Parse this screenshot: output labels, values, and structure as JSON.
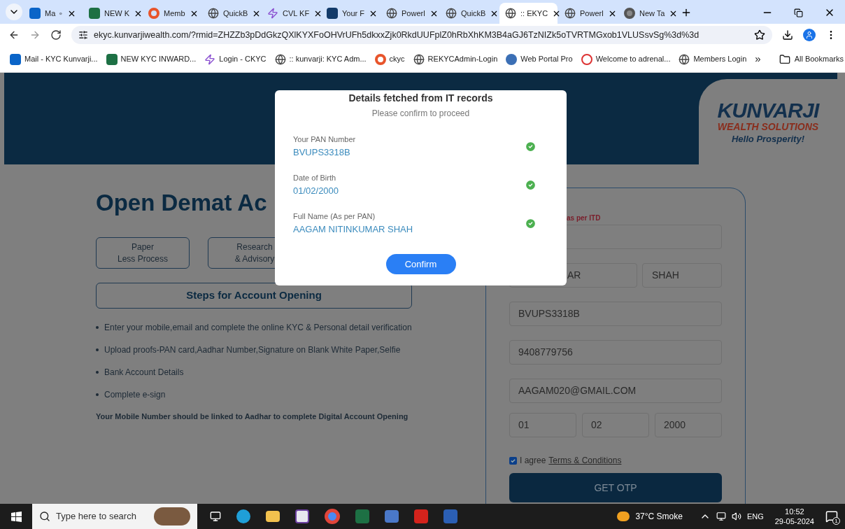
{
  "browser": {
    "tabs": [
      {
        "title": "Ma",
        "kind": "outlook",
        "audio": true,
        "selected": false
      },
      {
        "title": "NEW K",
        "kind": "excel",
        "audio": false,
        "selected": false
      },
      {
        "title": "Memb",
        "kind": "ring",
        "audio": false,
        "selected": false
      },
      {
        "title": "QuickB",
        "kind": "globe",
        "audio": false,
        "selected": false
      },
      {
        "title": "CVL KF",
        "kind": "bolt",
        "audio": false,
        "selected": false
      },
      {
        "title": "Your F",
        "kind": "k",
        "audio": false,
        "selected": false
      },
      {
        "title": "Powerl",
        "kind": "globe",
        "audio": false,
        "selected": false
      },
      {
        "title": "QuickB",
        "kind": "globe",
        "audio": false,
        "selected": false
      },
      {
        "title": ":: EKYC",
        "kind": "globe",
        "audio": false,
        "selected": true
      },
      {
        "title": "Powerl",
        "kind": "globe",
        "audio": false,
        "selected": false
      },
      {
        "title": "New Ta",
        "kind": "chrome",
        "audio": false,
        "selected": false
      }
    ],
    "url": "ekyc.kunvarjiwealth.com/?rmid=ZHZZb3pDdGkzQXlKYXFoOHVrUFh5dkxxZjk0RkdUUFplZ0hRbXhKM3B4aGJ6TzNIZk5oTVRTMGxob1VLUSsvSg%3d%3d",
    "bookmarks": [
      {
        "title": "Mail - KYC Kunvarji...",
        "kind": "outlook"
      },
      {
        "title": "NEW KYC INWARD...",
        "kind": "excel"
      },
      {
        "title": "Login - CKYC",
        "kind": "bolt"
      },
      {
        "title": ":: kunvarji: KYC Adm...",
        "kind": "globe"
      },
      {
        "title": "ckyc",
        "kind": "ring"
      },
      {
        "title": "REKYCAdmin-Login",
        "kind": "globe"
      },
      {
        "title": "Web Portal Pro",
        "kind": "ball"
      },
      {
        "title": "Welcome to adrenal...",
        "kind": "a"
      },
      {
        "title": "Members Login",
        "kind": "globe"
      }
    ],
    "more": "»",
    "all_bookmarks": "All Bookmarks"
  },
  "logo": {
    "name": "KUNVARJI",
    "sub": "WEALTH SOLUTIONS",
    "tagline": "Hello Prosperity!"
  },
  "title": "Open Demat Ac",
  "features": [
    {
      "lines": [
        "Paper",
        "Less Process"
      ]
    },
    {
      "lines": [
        "Research",
        "& Advisory"
      ]
    }
  ],
  "steps_title": "Steps for Account Opening",
  "steps": [
    "Enter your mobile,email and complete the online KYC & Personal detail verification",
    "Upload proofs-PAN card,Aadhar Number,Signature on Blank White Paper,Selfie",
    "Bank Account Details",
    "Complete e-sign"
  ],
  "note": "Your Mobile Number should be linked to Aadhar to complete Digital Account Opening",
  "form": {
    "label": "as per ITD",
    "name_fields": [
      "AR",
      "SHAH"
    ],
    "pan": "BVUPS3318B",
    "mobile": "9408779756",
    "email": "AAGAM020@GMAIL.COM",
    "dob": [
      "01",
      "02",
      "2000"
    ],
    "agree": {
      "checked": true,
      "text": "I agree",
      "link": "Terms & Conditions"
    },
    "button": "GET OTP"
  },
  "modal": {
    "title": "Details fetched from IT records",
    "subtitle": "Please confirm to proceed",
    "items": [
      {
        "label": "Your PAN Number",
        "value": "BVUPS3318B",
        "verified": true
      },
      {
        "label": "Date of Birth",
        "value": "01/02/2000",
        "verified": true
      },
      {
        "label": "Full Name (As per PAN)",
        "value": "AAGAM NITINKUMAR SHAH",
        "verified": true
      }
    ],
    "button": "Confirm"
  },
  "taskbar": {
    "search_placeholder": "Type here to search",
    "weather": "37°C Smoke",
    "language": "ENG",
    "time": "10:52",
    "date": "29-05-2024",
    "notifications": "1"
  }
}
